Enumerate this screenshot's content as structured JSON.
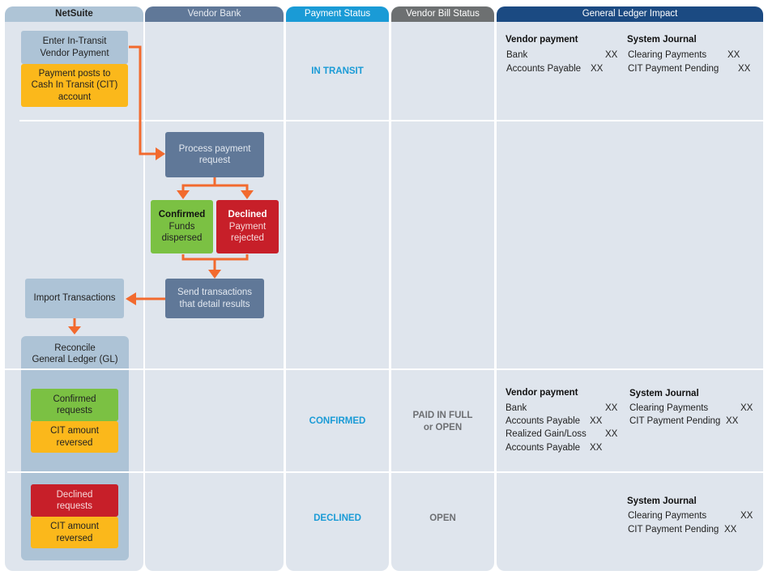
{
  "lanes": {
    "netsuite": {
      "label": "NetSuite",
      "color": "#aec4d6"
    },
    "vendor_bank": {
      "label": "Vendor Bank",
      "color": "#607898"
    },
    "payment_status": {
      "label": "Payment Status",
      "color": "#1a9bd6"
    },
    "vendor_bill_status": {
      "label": "Vendor Bill Status",
      "color": "#6d7071"
    },
    "gl_impact": {
      "label": "General Ledger Impact",
      "color": "#1b4a82"
    }
  },
  "flow": {
    "enter_payment": "Enter In-Transit\nVendor Payment",
    "payment_posts": "Payment posts to\nCash In Transit (CIT)\naccount",
    "process_request": "Process payment\nrequest",
    "confirmed_title": "Confirmed",
    "confirmed_sub": "Funds\ndispersed",
    "declined_title": "Declined",
    "declined_sub": "Payment\nrejected",
    "send_transactions": "Send transactions\nthat detail results",
    "import_transactions": "Import Transactions",
    "reconcile": "Reconcile\nGeneral Ledger (GL)",
    "confirmed_requests": "Confirmed\nrequests",
    "cit_reversed_1": "CIT amount\nreversed",
    "declined_requests": "Declined\nrequests",
    "cit_reversed_2": "CIT amount\nreversed"
  },
  "rows": {
    "in_transit": {
      "payment_status": "IN TRANSIT",
      "vendor_bill_status": "",
      "vendor_payment": {
        "title": "Vendor payment",
        "entries": [
          {
            "account": "Bank",
            "amount": "XX"
          },
          {
            "account": "Accounts Payable",
            "amount": "XX"
          }
        ]
      },
      "system_journal": {
        "title": "System Journal",
        "entries": [
          {
            "account": "Clearing Payments",
            "amount": "XX"
          },
          {
            "account": "CIT Payment Pending",
            "amount": "XX"
          }
        ]
      }
    },
    "confirmed": {
      "payment_status": "CONFIRMED",
      "vendor_bill_status": "PAID IN FULL\nor OPEN",
      "vendor_payment": {
        "title": "Vendor payment",
        "entries": [
          {
            "account": "Bank",
            "amount": "XX"
          },
          {
            "account": "Accounts Payable",
            "amount": "XX"
          },
          {
            "account": "Realized Gain/Loss",
            "amount": "XX"
          },
          {
            "account": "Accounts Payable",
            "amount": "XX"
          }
        ]
      },
      "system_journal": {
        "title": "System Journal",
        "entries": [
          {
            "account": "Clearing Payments",
            "amount": "XX"
          },
          {
            "account": "CIT Payment Pending",
            "amount": "XX"
          }
        ]
      }
    },
    "declined": {
      "payment_status": "DECLINED",
      "vendor_bill_status": "OPEN",
      "system_journal": {
        "title": "System Journal",
        "entries": [
          {
            "account": "Clearing Payments",
            "amount": "XX"
          },
          {
            "account": "CIT Payment Pending",
            "amount": "XX"
          }
        ]
      }
    }
  },
  "colors": {
    "lane_bg": "#dfe5ed",
    "netsuite_box": "#adc3d6",
    "yellow": "#fbb81b",
    "green": "#7bc143",
    "red": "#c71f29",
    "bank_box": "#607898",
    "arrow": "#f26a2e",
    "status_blue": "#1a9bd6",
    "status_gray": "#6d6f72"
  }
}
